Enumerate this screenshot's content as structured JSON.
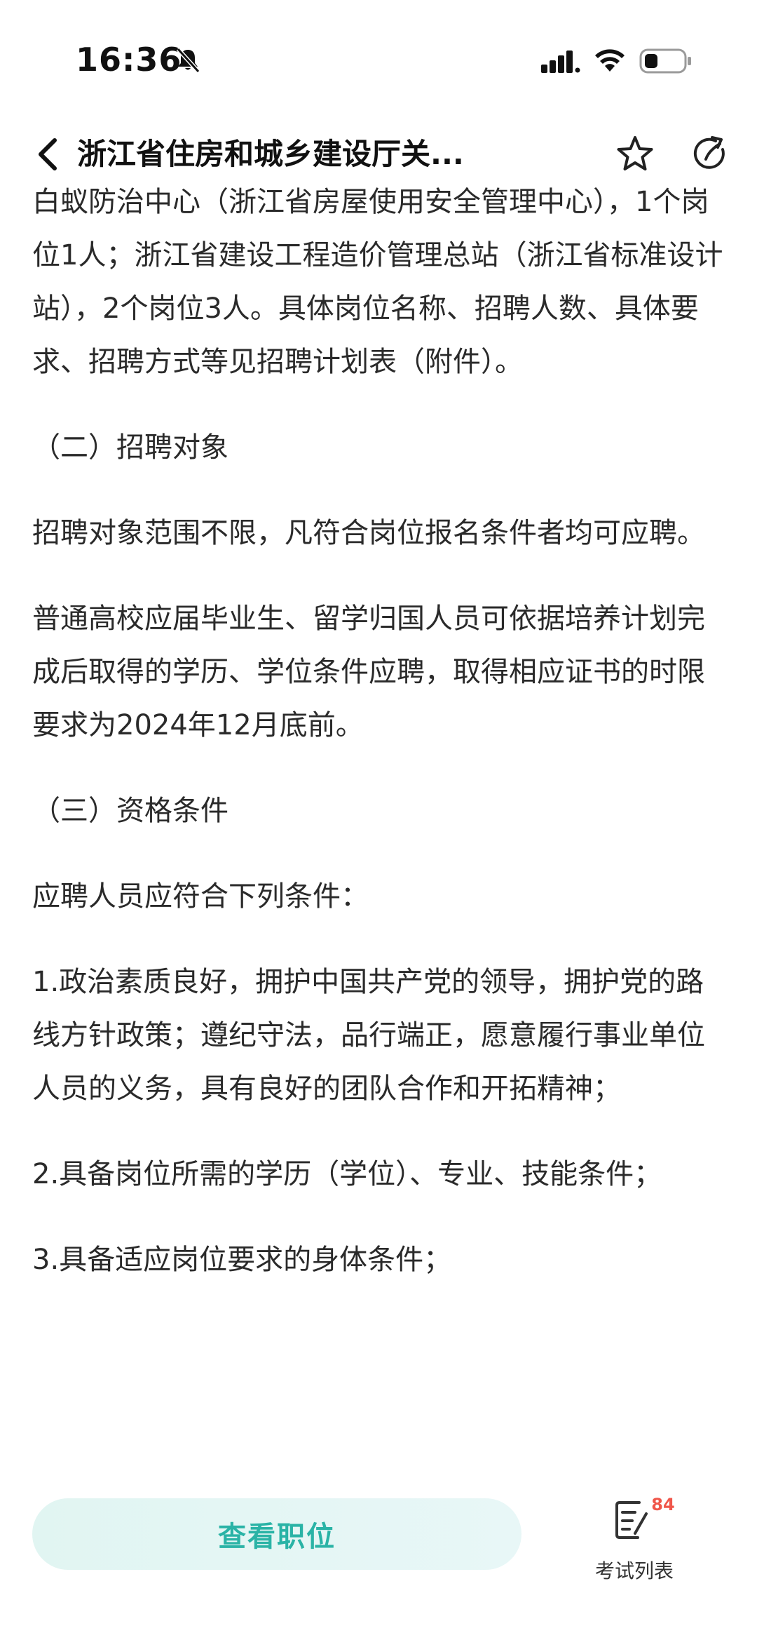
{
  "status_bar": {
    "time": "16:36",
    "icons": [
      "bell-off-icon",
      "signal-icon",
      "wifi-icon",
      "battery-icon"
    ]
  },
  "header": {
    "title": "浙江省住房和城乡建设厅关...",
    "icons": [
      "chevron-left-icon",
      "star-icon",
      "share-icon"
    ]
  },
  "article": {
    "paragraphs": [
      {
        "text": "白蚁防治中心（浙江省房屋使用安全管理中心），1个岗位1人；浙江省建设工程造价管理总站（浙江省标准设计站），2个岗位3人。具体岗位名称、招聘人数、具体要求、招聘方式等见招聘计划表（附件）。"
      },
      {
        "text": "（二）招聘对象"
      },
      {
        "text": "招聘对象范围不限，凡符合岗位报名条件者均可应聘。"
      },
      {
        "text": "普通高校应届毕业生、留学归国人员可依据培养计划完成后取得的学历、学位条件应聘，取得相应证书的时限要求为2024年12月底前。"
      },
      {
        "text": "（三）资格条件"
      },
      {
        "text": "应聘人员应符合下列条件："
      },
      {
        "text": "1.政治素质良好，拥护中国共产党的领导，拥护党的路线方针政策；遵纪守法，品行端正，愿意履行事业单位人员的义务，具有良好的团队合作和开拓精神；"
      },
      {
        "text": "2.具备岗位所需的学历（学位）、专业、技能条件；"
      },
      {
        "text": "3.具备适应岗位要求的身体条件；"
      }
    ]
  },
  "bottom_bar": {
    "view_positions_label": "查看职位",
    "exam_list_label": "考试列表",
    "exam_list_badge": "84",
    "accent_color": "#2ab3a6",
    "badge_color": "#f0564a"
  }
}
